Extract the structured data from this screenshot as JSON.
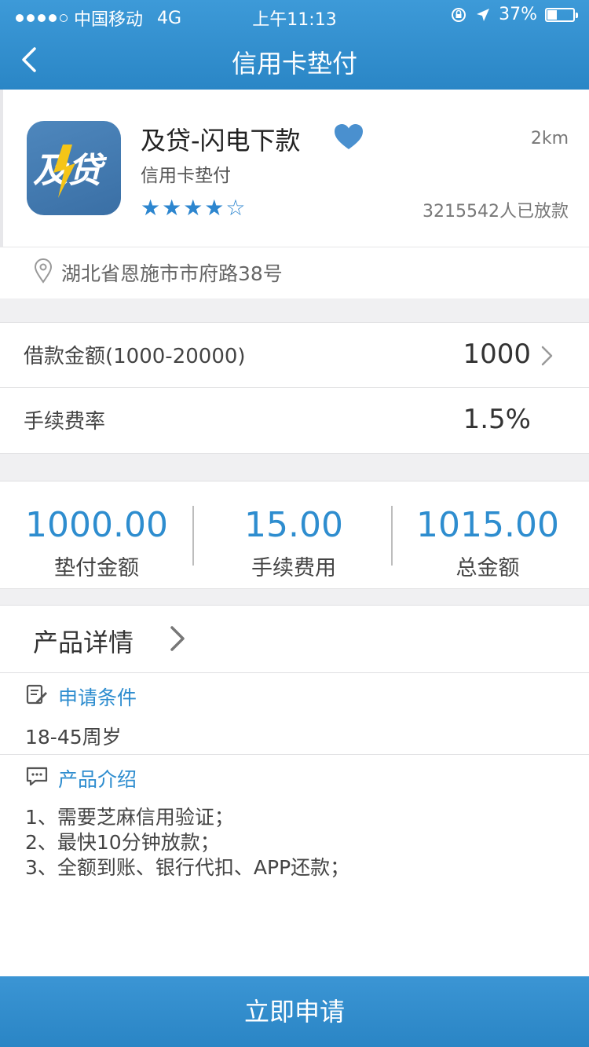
{
  "status_bar": {
    "carrier": "中国移动",
    "network": "4G",
    "time": "上午11:13",
    "battery": "37%",
    "battery_level": 0.37
  },
  "nav": {
    "title": "信用卡垫付"
  },
  "product": {
    "name": "及贷-闪电下款",
    "subtitle": "信用卡垫付",
    "distance": "2km",
    "rating_stars": "★★★★☆",
    "rating": 4,
    "loans_count": "3215542人已放款",
    "logo_text": "及贷",
    "favorite_color": "#4a90cf"
  },
  "address": "湖北省恩施市市府路38号",
  "loan": {
    "amount_label": "借款金额(1000-20000)",
    "amount_value": "1000",
    "fee_label": "手续费率",
    "fee_value": "1.5%"
  },
  "summary": [
    {
      "value": "1000.00",
      "label": "垫付金额"
    },
    {
      "value": "15.00",
      "label": "手续费用"
    },
    {
      "value": "1015.00",
      "label": "总金额"
    }
  ],
  "details": {
    "title": "产品详情",
    "conditions_title": "申请条件",
    "conditions_text": "18-45周岁",
    "intro_title": "产品介绍",
    "intro_items": [
      "1、需要芝麻信用验证；",
      "2、最快10分钟放款；",
      "3、全额到账、银行代扣、APP还款；"
    ]
  },
  "apply_button": "立即申请",
  "colors": {
    "primary": "#2e8dcf",
    "header": "#3391d0"
  }
}
